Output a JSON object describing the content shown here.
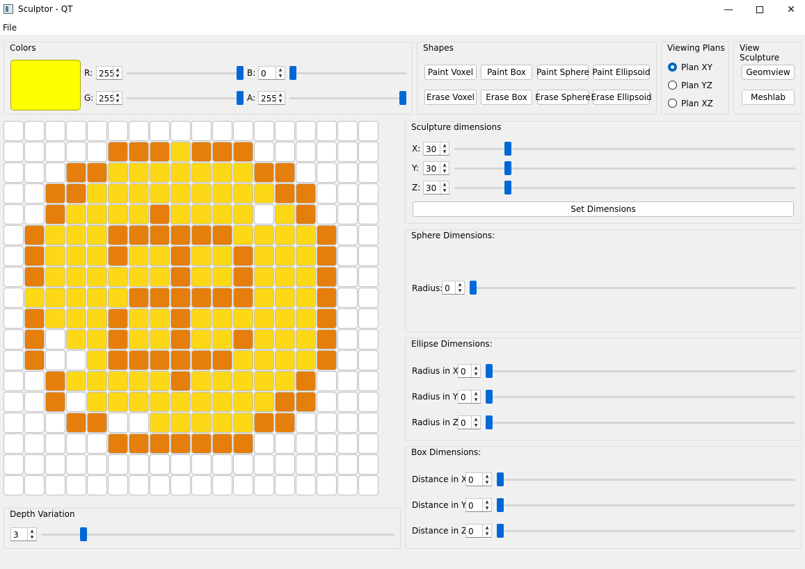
{
  "window": {
    "title": "Sculptor - QT",
    "min_glyph": "—",
    "close_glyph": "✕"
  },
  "menu": {
    "file": "File"
  },
  "colors": {
    "title": "Colors",
    "swatch_color": "#ffff00",
    "r": {
      "label": "R:",
      "value": "255",
      "level": 1.0
    },
    "g": {
      "label": "G:",
      "value": "255",
      "level": 1.0
    },
    "b": {
      "label": "B:",
      "value": "0",
      "level": 0.0
    },
    "a": {
      "label": "A:",
      "value": "255",
      "level": 1.0
    }
  },
  "shapes": {
    "title": "Shapes",
    "paint_voxel": "Paint Voxel",
    "paint_box": "Paint Box",
    "paint_sphere": "Paint Sphere",
    "paint_ellipsoid": "Paint Ellipsoid",
    "erase_voxel": "Erase Voxel",
    "erase_box": "Erase Box",
    "erase_sphere": "Erase Sphere",
    "erase_ellipsoid": "Erase Ellipsoid"
  },
  "viewing": {
    "title": "Viewing Plans",
    "xy": "Plan XY",
    "yz": "Plan YZ",
    "xz": "Plan XZ",
    "selected": "xy"
  },
  "view_sculpture": {
    "title": "View Sculpture",
    "geomview": "Geomview",
    "meshlab": "Meshlab"
  },
  "sculpture_dims": {
    "title": "Sculpture dimensions",
    "x": {
      "label": "X:",
      "value": "30",
      "level": 0.15
    },
    "y": {
      "label": "Y:",
      "value": "30",
      "level": 0.15
    },
    "z": {
      "label": "Z:",
      "value": "30",
      "level": 0.15
    },
    "set_button": "Set Dimensions"
  },
  "sphere_dims": {
    "title": "Sphere Dimensions:",
    "radius": {
      "label": "Radius:",
      "value": "0",
      "level": 0
    }
  },
  "ellipse_dims": {
    "title": "Ellipse Dimensions:",
    "rx": {
      "label": "Radius in X:",
      "value": "0",
      "level": 0
    },
    "ry": {
      "label": "Radius in Y:",
      "value": "0",
      "level": 0
    },
    "rz": {
      "label": "Radius in Z:",
      "value": "0",
      "level": 0
    }
  },
  "box_dims": {
    "title": "Box Dimensions:",
    "dx": {
      "label": "Distance in X:",
      "value": "0",
      "level": 0
    },
    "dy": {
      "label": "Distance in Y:",
      "value": "0",
      "level": 0
    },
    "dz": {
      "label": "Distance in Z:",
      "value": "0",
      "level": 0
    }
  },
  "depth": {
    "title": "Depth Variation",
    "value": "3",
    "level": 0.11
  },
  "grid": {
    "palette": {
      ".": "#ffffff",
      "o": "#e57e0a",
      "y": "#fdd817"
    },
    "rows": [
      "..................",
      ".....oooyooo......",
      "...ooyyyyyyyoo....",
      "..ooyyyyyyyyyoo...",
      "..oyyyyoyyyy.yo...",
      ".oyyyooooooyyyyo..",
      ".oyyyoyyoyyoyyyo..",
      ".oyyyyyyoyyoyyyo..",
      ".yyyyyooooooyyyo..",
      ".oyyyoyyoyyyyyyo..",
      ".o.yyoyyoyyoyyyo..",
      ".o..yooooooyyyyo..",
      "..oyyyyyoyyyyyo...",
      "..o.yyyyyyyyyoo...",
      "...oo..yyyyyoo....",
      ".....ooooooo......",
      "..................",
      ".................."
    ]
  }
}
